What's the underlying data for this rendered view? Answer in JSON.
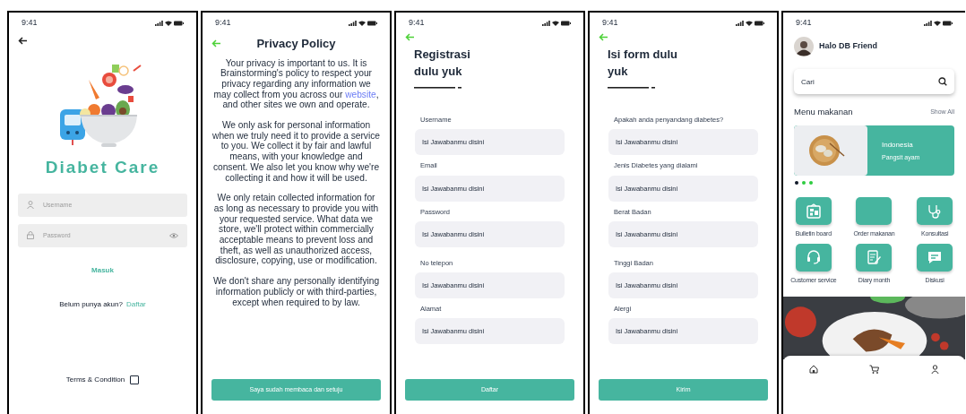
{
  "login": {
    "time": "9:41",
    "app_name": "Diabet Care",
    "fields": [
      {
        "placeholder": "Username"
      },
      {
        "placeholder": "Password"
      }
    ],
    "login_button": "Masuk",
    "signup_prompt": "Belum punya akun?",
    "signup_link": "Daftar",
    "terms": {
      "label": "Terms & Condition",
      "checked": false
    }
  },
  "privacy": {
    "time": "9:41",
    "title": "Privacy Policy",
    "paragraphs": [
      {
        "before": "Your privacy is important to us. It is Brainstorming's policy to respect your privacy regarding any information we may collect from you across our ",
        "link": "website",
        "after": ", and other sites we own and operate."
      },
      {
        "before": "We only ask for personal information when we truly need it to provide a service to you. We collect it by fair and lawful means, with your knowledge and consent. We also let you know why we're collecting it and how it will be used."
      },
      {
        "before": "We only retain collected information for as long as necessary to provide you with your requested service. What data we store, we'll protect within commercially acceptable means to prevent loss and theft, as well as unauthorized access, disclosure, copying, use or modification."
      },
      {
        "before": "We don't share any personally identifying information publicly or with third-parties, except when required to by law."
      }
    ],
    "button": "Saya sudah membaca dan setuju"
  },
  "registration": {
    "time": "9:41",
    "title_lines": [
      "Registrasi",
      "dulu yuk"
    ],
    "fields": [
      {
        "label": "Username",
        "placeholder": "Isi Jawabanmu disini"
      },
      {
        "label": "Email",
        "placeholder": "Isi Jawabanmu disini"
      },
      {
        "label": "Password",
        "placeholder": "Isi Jawabanmu disini"
      },
      {
        "label": "No telepon",
        "placeholder": "Isi Jawabanmu disini"
      },
      {
        "label": "Alamat",
        "placeholder": "Isi Jawabanmu disini"
      }
    ],
    "button": "Daftar"
  },
  "health_form": {
    "time": "9:41",
    "title_lines": [
      "Isi form dulu",
      "yuk"
    ],
    "fields": [
      {
        "label": "Apakah anda penyandang diabetes?",
        "placeholder": "Isi Jawabanmu disini"
      },
      {
        "label": "Jenis Diabetes yang dialami",
        "placeholder": "Isi Jawabanmu disini"
      },
      {
        "label": "Berat Badan",
        "placeholder": "Isi Jawabanmu disini"
      },
      {
        "label": "Tinggi Badan",
        "placeholder": "Isi Jawabanmu disini"
      },
      {
        "label": "Alergi",
        "placeholder": "Isi Jawabanmu disini"
      }
    ],
    "button": "Kirim"
  },
  "home": {
    "time": "9:41",
    "greeting": "Halo DB Friend",
    "search": {
      "placeholder": "Cari"
    },
    "section_title": "Menu makanan",
    "show_all": "Show All",
    "banner": {
      "title": "Indonesia",
      "subtitle": "Pangsit ayam"
    },
    "carousel_dots": [
      {
        "selected": true
      },
      {
        "selected": false
      },
      {
        "selected": false
      }
    ],
    "menu": [
      {
        "kind": "bulletin",
        "label": "Bulletin board"
      },
      {
        "kind": "blank",
        "label": "Order makanan"
      },
      {
        "kind": "stethoscope",
        "label": "Konsultasi"
      },
      {
        "kind": "headset",
        "label": "Customer service"
      },
      {
        "kind": "notepad",
        "label": "Diary month"
      },
      {
        "kind": "chat",
        "label": "Diskusi"
      }
    ]
  }
}
